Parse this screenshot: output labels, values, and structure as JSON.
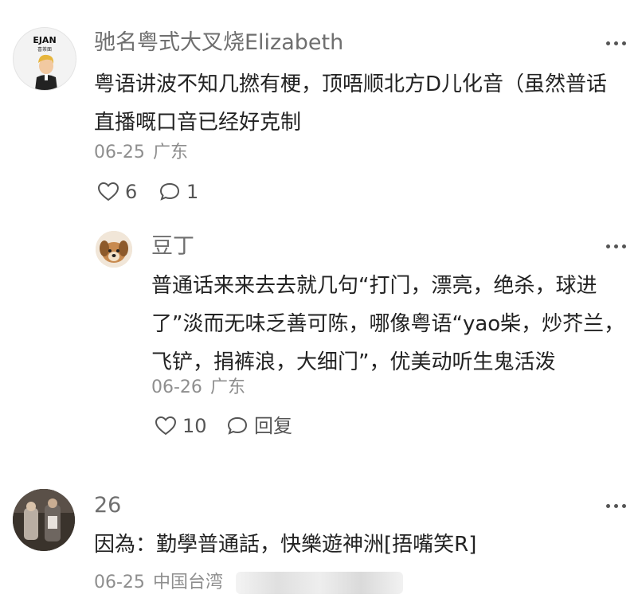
{
  "comments": [
    {
      "username": "驰名粤式大叉烧Elizabeth",
      "avatar_text": "EJAN",
      "avatar_sub": "喜茶面",
      "text": "粤语讲波不知几撚有梗，顶唔顺北方D儿化音（虽然普话直播嘅口音已经好克制",
      "date": "06-25",
      "location": "广东",
      "likes": "6",
      "replies": "1"
    },
    {
      "username": "豆丁",
      "text": "普通话来来去去就几句“打门，漂亮，绝杀，球进了”淡而无味乏善可陈，哪像粤语“yao柴，炒芥兰，飞铲，捐裤浪，大细门”，优美动听生鬼活泼",
      "date": "06-26",
      "location": "广东",
      "likes": "10",
      "reply_label": "回复"
    },
    {
      "username": "26",
      "text": "因為：勤學普通話，快樂遊神洲[捂嘴笑R]",
      "date": "06-25",
      "location": "中国台湾"
    }
  ],
  "colors": {
    "text": "#222222",
    "username": "#6f6f6f",
    "meta": "#8e8e8e"
  }
}
